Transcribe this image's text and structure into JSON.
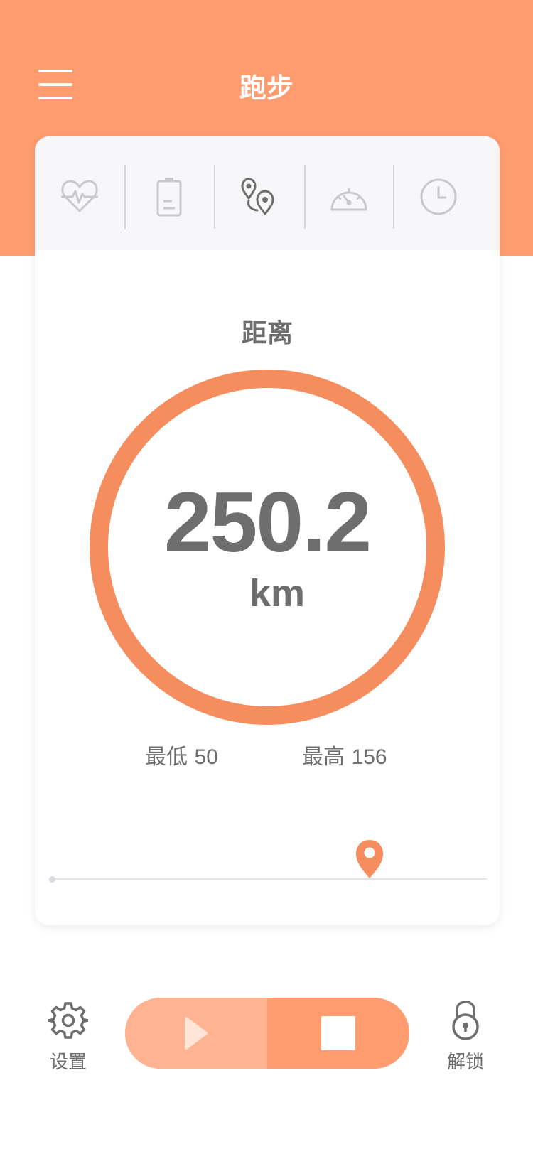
{
  "header": {
    "title": "跑步",
    "menu_icon": "hamburger-menu-icon",
    "background_color": "#FF9C70"
  },
  "tabs": [
    {
      "icon": "heart-pulse-icon",
      "active": false
    },
    {
      "icon": "battery-icon",
      "active": false
    },
    {
      "icon": "route-pins-icon",
      "active": true
    },
    {
      "icon": "speedometer-icon",
      "active": false
    },
    {
      "icon": "clock-icon",
      "active": false
    }
  ],
  "metric": {
    "label": "距离",
    "value": "250.2",
    "unit": "km",
    "ring_color": "#F58D5F"
  },
  "stats": {
    "min_label": "最低",
    "min_value": "50",
    "max_label": "最高",
    "max_value": "156"
  },
  "track": {
    "marker_icon": "location-pin-icon",
    "marker_color": "#F58D5F",
    "marker_progress": 0.73
  },
  "bottom_bar": {
    "settings_label": "设置",
    "settings_icon": "gear-icon",
    "unlock_label": "解锁",
    "unlock_icon": "lock-icon",
    "play_icon": "play-icon",
    "stop_icon": "stop-icon",
    "play_color": "#FFB391",
    "stop_color": "#FF9C70"
  }
}
